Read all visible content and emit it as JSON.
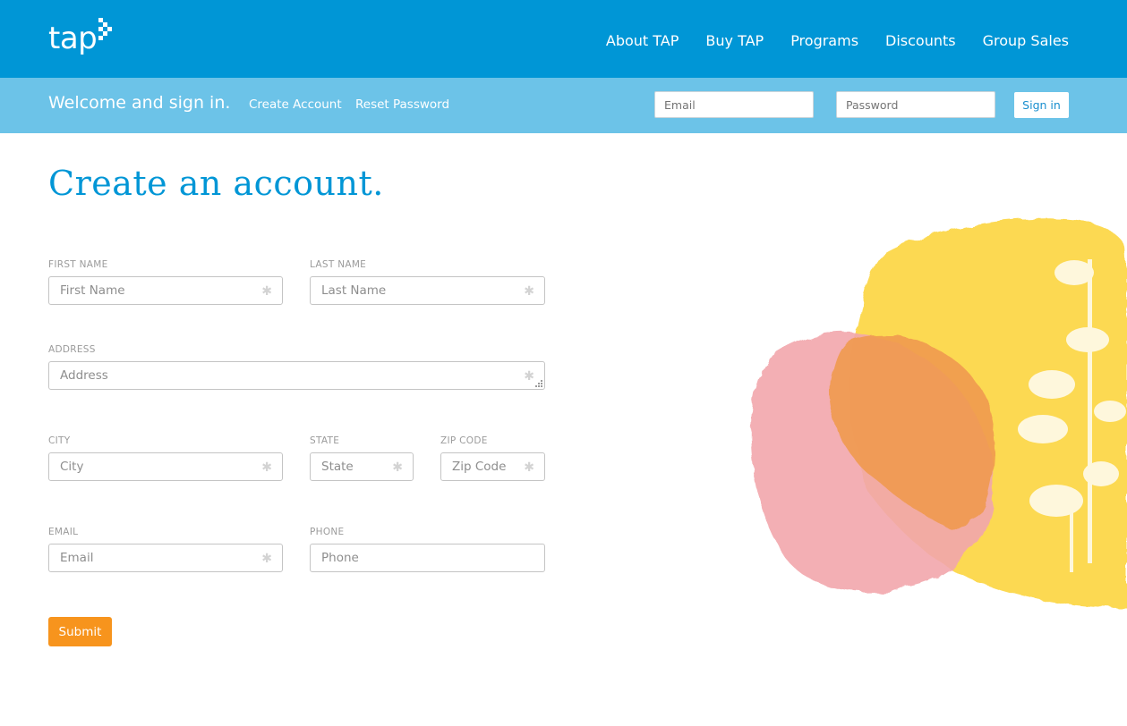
{
  "header": {
    "logo_text": "tap",
    "nav": [
      {
        "label": "About TAP"
      },
      {
        "label": "Buy TAP"
      },
      {
        "label": "Programs"
      },
      {
        "label": "Discounts"
      },
      {
        "label": "Group Sales"
      }
    ]
  },
  "signin_bar": {
    "welcome": "Welcome and sign in.",
    "create_account": "Create Account",
    "reset_password": "Reset Password",
    "email_placeholder": "Email",
    "password_placeholder": "Password",
    "signin_label": "Sign in"
  },
  "page": {
    "title": "Create an account."
  },
  "form": {
    "first_name": {
      "label": "FIRST NAME",
      "placeholder": "First Name",
      "value": "",
      "required": true
    },
    "last_name": {
      "label": "LAST NAME",
      "placeholder": "Last Name",
      "value": "",
      "required": true
    },
    "address": {
      "label": "ADDRESS",
      "placeholder": "Address",
      "value": "",
      "required": true
    },
    "city": {
      "label": "CITY",
      "placeholder": "City",
      "value": "",
      "required": true
    },
    "state": {
      "label": "STATE",
      "placeholder": "State",
      "value": "",
      "required": true
    },
    "zip": {
      "label": "ZIP CODE",
      "placeholder": "Zip Code",
      "value": "",
      "required": true
    },
    "email": {
      "label": "EMAIL",
      "placeholder": "Email",
      "value": "",
      "required": true
    },
    "phone": {
      "label": "PHONE",
      "placeholder": "Phone",
      "value": "",
      "required": false
    },
    "required_marker": "✱",
    "submit_label": "Submit"
  },
  "colors": {
    "brand_blue": "#0096d6",
    "light_blue": "#6cc3e8",
    "accent_orange": "#f7941d"
  }
}
